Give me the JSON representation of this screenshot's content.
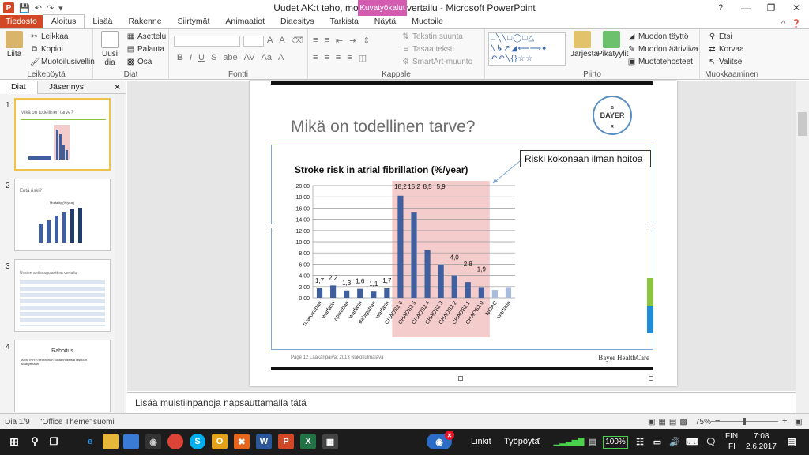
{
  "window": {
    "title": "Uudet AK:t teho, mortaliteetti ja vertailu  -  Microsoft PowerPoint",
    "context_tab": "Kuvatyökalut"
  },
  "tabs": [
    {
      "label": "Tiedosto"
    },
    {
      "label": "Aloitus"
    },
    {
      "label": "Lisää"
    },
    {
      "label": "Rakenne"
    },
    {
      "label": "Siirtymät"
    },
    {
      "label": "Animaatiot"
    },
    {
      "label": "Diaesitys"
    },
    {
      "label": "Tarkista"
    },
    {
      "label": "Näytä"
    },
    {
      "label": "Muotoile"
    }
  ],
  "ribbon": {
    "clipboard": {
      "paste": "Liitä",
      "cut": "Leikkaa",
      "copy": "Kopioi",
      "format_painter": "Muotoilusivellin",
      "label": "Leikepöytä"
    },
    "slides": {
      "new_slide": "Uusi dia",
      "layout": "Asettelu",
      "reset": "Palauta",
      "section": "Osa",
      "label": "Diat"
    },
    "font": {
      "label": "Fontti",
      "size_up": "A",
      "size_down": "A",
      "bold": "B",
      "italic": "I",
      "underline": "U",
      "strike": "S",
      "spacing": "AV",
      "case": "Aa",
      "color": "A"
    },
    "paragraph": {
      "text_direction": "Tekstin suunta",
      "align_text": "Tasaa teksti",
      "smartart": "SmartArt-muunto",
      "label": "Kappale"
    },
    "drawing": {
      "arrange": "Järjestä",
      "quick_styles": "Pikatyylit",
      "shape_fill": "Muodon täyttö",
      "shape_outline": "Muodon ääriviiva",
      "shape_effects": "Muototehosteet",
      "label": "Piirto"
    },
    "editing": {
      "find": "Etsi",
      "replace": "Korvaa",
      "select": "Valitse",
      "label": "Muokkaaminen"
    }
  },
  "left_pane": {
    "tabs": [
      "Diat",
      "Jäsennys"
    ],
    "slides": [
      {
        "num": "1",
        "title": "Mikä on todellinen tarve?"
      },
      {
        "num": "2",
        "title": "Entä riski?",
        "chart_title": "Mortality (%/year)"
      },
      {
        "num": "3",
        "title": "Uusien antikoagulanttien vertailu"
      },
      {
        "num": "4",
        "title": "Rahoitus",
        "bullet": "Arvio INR:n seurannan kustannuksista laskuun sisällytetään"
      }
    ]
  },
  "slide": {
    "title": "Mikä on todellinen tarve?",
    "callout": "Riski kokonaan ilman hoitoa",
    "footer_left": "Page 12   Lääkäripäivät 2013   Näkökulmalava",
    "footer_right": "Bayer HealthCare",
    "logo_text": [
      "BAYER",
      "BAYER"
    ]
  },
  "chart_data": {
    "type": "bar",
    "title": "Stroke risk in atrial fibrillation (%/year)",
    "xlabel": "",
    "ylabel": "",
    "ylim": [
      0,
      20
    ],
    "yticks": [
      "0,00",
      "2,00",
      "4,00",
      "6,00",
      "8,00",
      "10,00",
      "12,00",
      "14,00",
      "16,00",
      "18,00",
      "20,00"
    ],
    "categories": [
      "rivaroxaban",
      "warfarin",
      "apixaban",
      "warfarin",
      "dabigatran",
      "warfarin",
      "CHADS2 6",
      "CHADS2 5",
      "CHADS2 4",
      "CHADS2 3",
      "CHADS2 2",
      "CHADS2 1",
      "CHADS2 0",
      "NOAC",
      "warfarin"
    ],
    "values": [
      1.7,
      2.2,
      1.3,
      1.6,
      1.1,
      1.7,
      18.2,
      15.2,
      8.5,
      5.9,
      4.0,
      2.8,
      1.9,
      1.4,
      1.9
    ],
    "data_labels": [
      "1,7",
      "2,2",
      "1,3",
      "1,6",
      "1,1",
      "1,7",
      "18,2",
      "15,2",
      "8,5",
      "5,9",
      "4,0",
      "2,8",
      "1,9",
      "",
      ""
    ],
    "highlight_range": [
      6,
      12
    ],
    "colors": {
      "bar": "#3f5f9e",
      "bar_light": "#aabcdc",
      "highlight": "#f4cccc"
    }
  },
  "notes": {
    "placeholder": "Lisää muistiinpanoja napsauttamalla tätä"
  },
  "status": {
    "slide": "Dia 1/9",
    "theme": "\"Office Theme\"",
    "language": "suomi",
    "zoom": "75%"
  },
  "taskbar": {
    "links": "Linkit",
    "desktop": "Työpöytä",
    "battery": "100%",
    "lang": "FIN",
    "lang2": "FI",
    "time": "7:08",
    "date": "2.6.2017"
  }
}
